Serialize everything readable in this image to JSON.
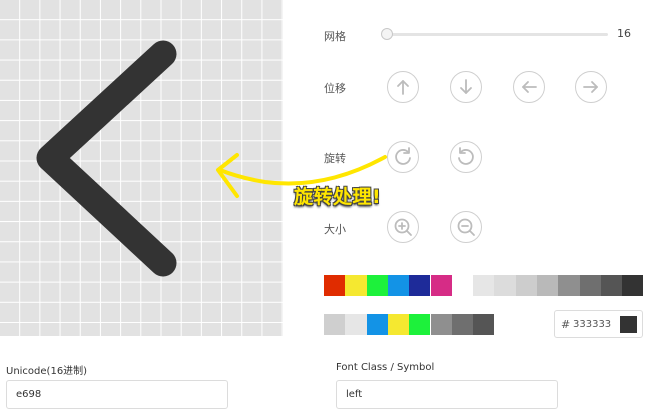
{
  "grid": {
    "label": "网格",
    "value": "16",
    "level_fraction": 0.0
  },
  "move": {
    "label": "位移",
    "buttons": [
      "arrow-up-icon",
      "arrow-down-icon",
      "arrow-left-icon",
      "arrow-right-icon"
    ]
  },
  "rotate": {
    "label": "旋转",
    "buttons": [
      "rotate-clockwise-icon",
      "rotate-counterclockwise-icon"
    ]
  },
  "size": {
    "label": "大小",
    "buttons": [
      "zoom-in-icon",
      "zoom-out-icon"
    ]
  },
  "annotation": {
    "text": "旋转处理!"
  },
  "palette": {
    "row1": [
      "#e02c00",
      "#f5e830",
      "#1df13b",
      "#1393e6",
      "#1e2b99",
      "#d62c86",
      "#ffffff",
      "#e6e6e6",
      "#dcdcdc",
      "#cdcdcd",
      "#b9b9b9",
      "#8f8f8f",
      "#6f6f6f",
      "#555555",
      "#333333"
    ],
    "row2": [
      "#cfcfcf",
      "#e6e6e6",
      "#1393e6",
      "#f5e830",
      "#1df13b",
      "#8f8f8f",
      "#6f6f6f",
      "#555555"
    ]
  },
  "color": {
    "hash": "#",
    "value": "333333",
    "preview": "#333333"
  },
  "unicode": {
    "label": "Unicode(16进制)",
    "value": "e698"
  },
  "font_class": {
    "label": "Font Class / Symbol",
    "value": "left"
  },
  "icon": {
    "name": "chevron-left-icon",
    "color": "#333333"
  }
}
